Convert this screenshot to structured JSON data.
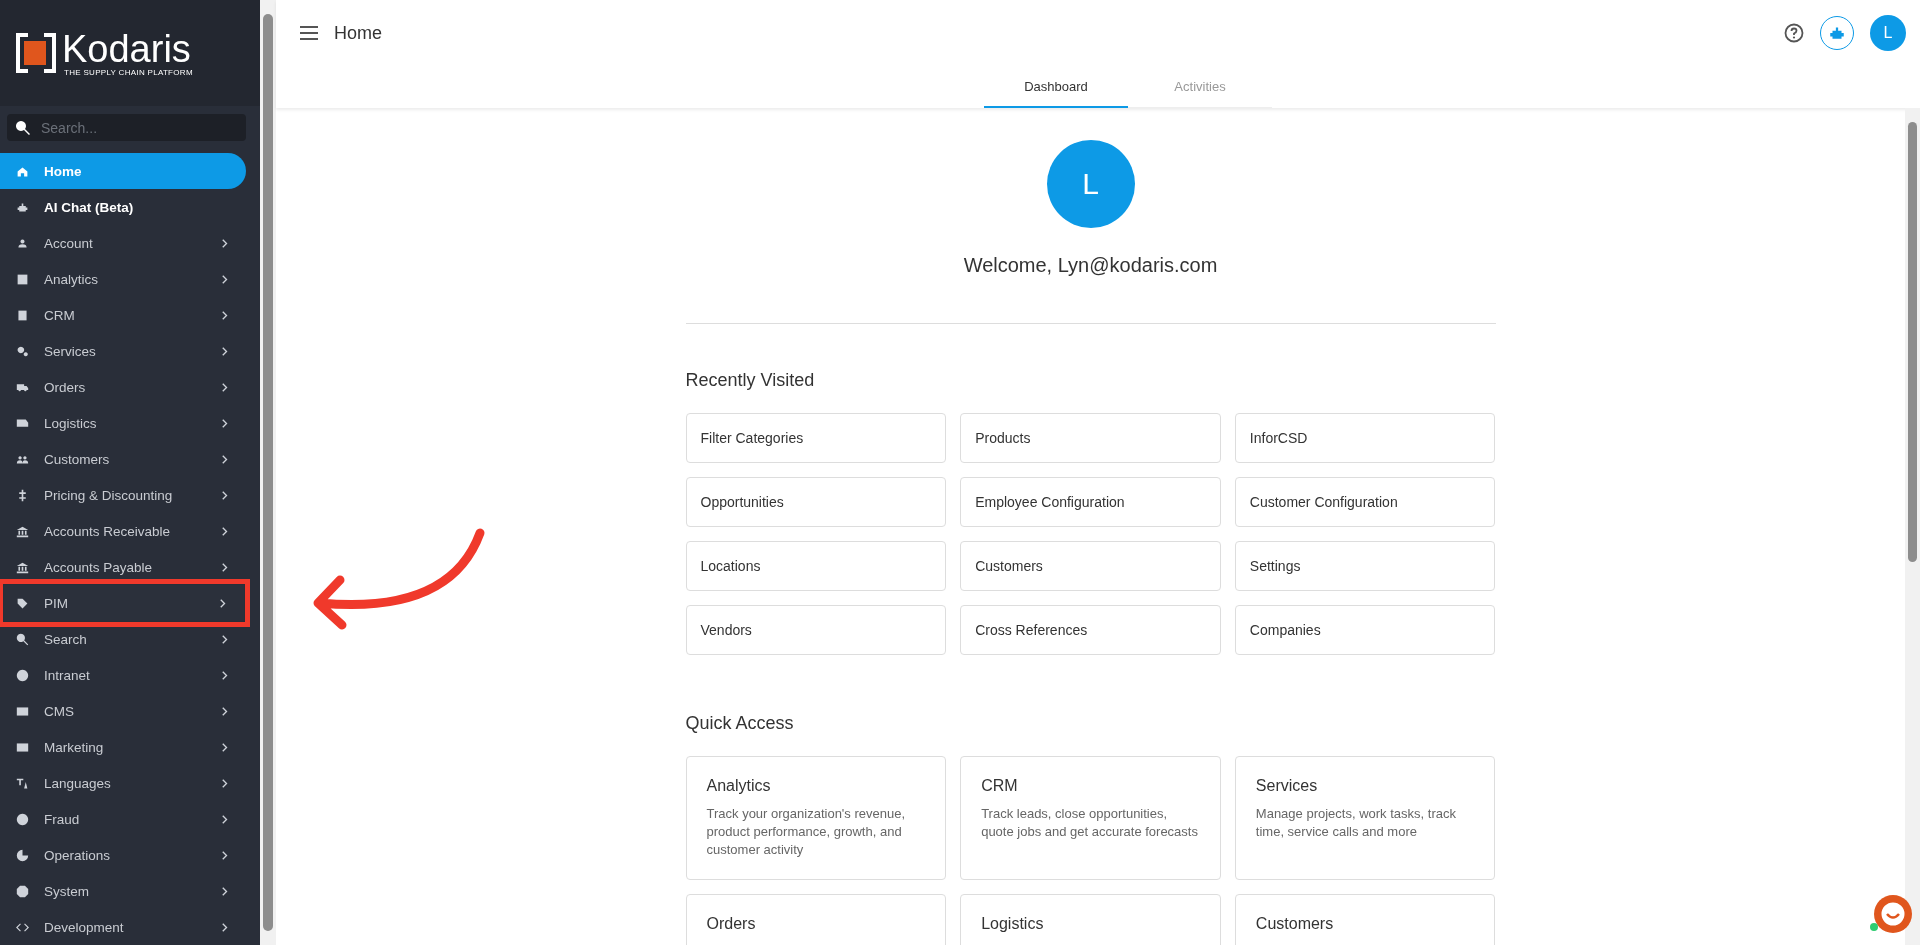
{
  "sidebar": {
    "logo": {
      "name": "Kodaris",
      "tagline": "THE SUPPLY CHAIN PLATFORM"
    },
    "search": {
      "placeholder": "Search..."
    },
    "items": [
      {
        "label": "Home",
        "selected": true,
        "expandable": false
      },
      {
        "label": "AI Chat (Beta)",
        "selected": false,
        "expandable": false
      },
      {
        "label": "Account",
        "selected": false,
        "expandable": true
      },
      {
        "label": "Analytics",
        "selected": false,
        "expandable": true
      },
      {
        "label": "CRM",
        "selected": false,
        "expandable": true
      },
      {
        "label": "Services",
        "selected": false,
        "expandable": true
      },
      {
        "label": "Orders",
        "selected": false,
        "expandable": true
      },
      {
        "label": "Logistics",
        "selected": false,
        "expandable": true
      },
      {
        "label": "Customers",
        "selected": false,
        "expandable": true
      },
      {
        "label": "Pricing & Discounting",
        "selected": false,
        "expandable": true
      },
      {
        "label": "Accounts Receivable",
        "selected": false,
        "expandable": true
      },
      {
        "label": "Accounts Payable",
        "selected": false,
        "expandable": true
      },
      {
        "label": "PIM",
        "selected": false,
        "expandable": true,
        "highlighted": true
      },
      {
        "label": "Search",
        "selected": false,
        "expandable": true
      },
      {
        "label": "Intranet",
        "selected": false,
        "expandable": true
      },
      {
        "label": "CMS",
        "selected": false,
        "expandable": true
      },
      {
        "label": "Marketing",
        "selected": false,
        "expandable": true
      },
      {
        "label": "Languages",
        "selected": false,
        "expandable": true
      },
      {
        "label": "Fraud",
        "selected": false,
        "expandable": true
      },
      {
        "label": "Operations",
        "selected": false,
        "expandable": true
      },
      {
        "label": "System",
        "selected": false,
        "expandable": true
      },
      {
        "label": "Development",
        "selected": false,
        "expandable": true
      }
    ]
  },
  "header": {
    "title": "Home",
    "user_initial": "L"
  },
  "tabs": [
    {
      "label": "Dashboard",
      "selected": true
    },
    {
      "label": "Activities",
      "selected": false
    }
  ],
  "profile": {
    "initial": "L",
    "welcome": "Welcome, Lyn@kodaris.com"
  },
  "recently_visited": {
    "title": "Recently Visited",
    "links": [
      "Filter Categories",
      "Products",
      "InforCSD",
      "Opportunities",
      "Employee Configuration",
      "Customer Configuration",
      "Locations",
      "Customers",
      "Settings",
      "Vendors",
      "Cross References",
      "Companies"
    ]
  },
  "quick_access": {
    "title": "Quick Access",
    "cards": [
      {
        "title": "Analytics",
        "description": "Track your organization's revenue, product performance, growth, and customer activity"
      },
      {
        "title": "CRM",
        "description": "Track leads, close opportunities, quote jobs and get accurate forecasts"
      },
      {
        "title": "Services",
        "description": "Manage projects, work tasks, track time, service calls and more"
      },
      {
        "title": "Orders"
      },
      {
        "title": "Logistics"
      },
      {
        "title": "Customers"
      }
    ]
  }
}
